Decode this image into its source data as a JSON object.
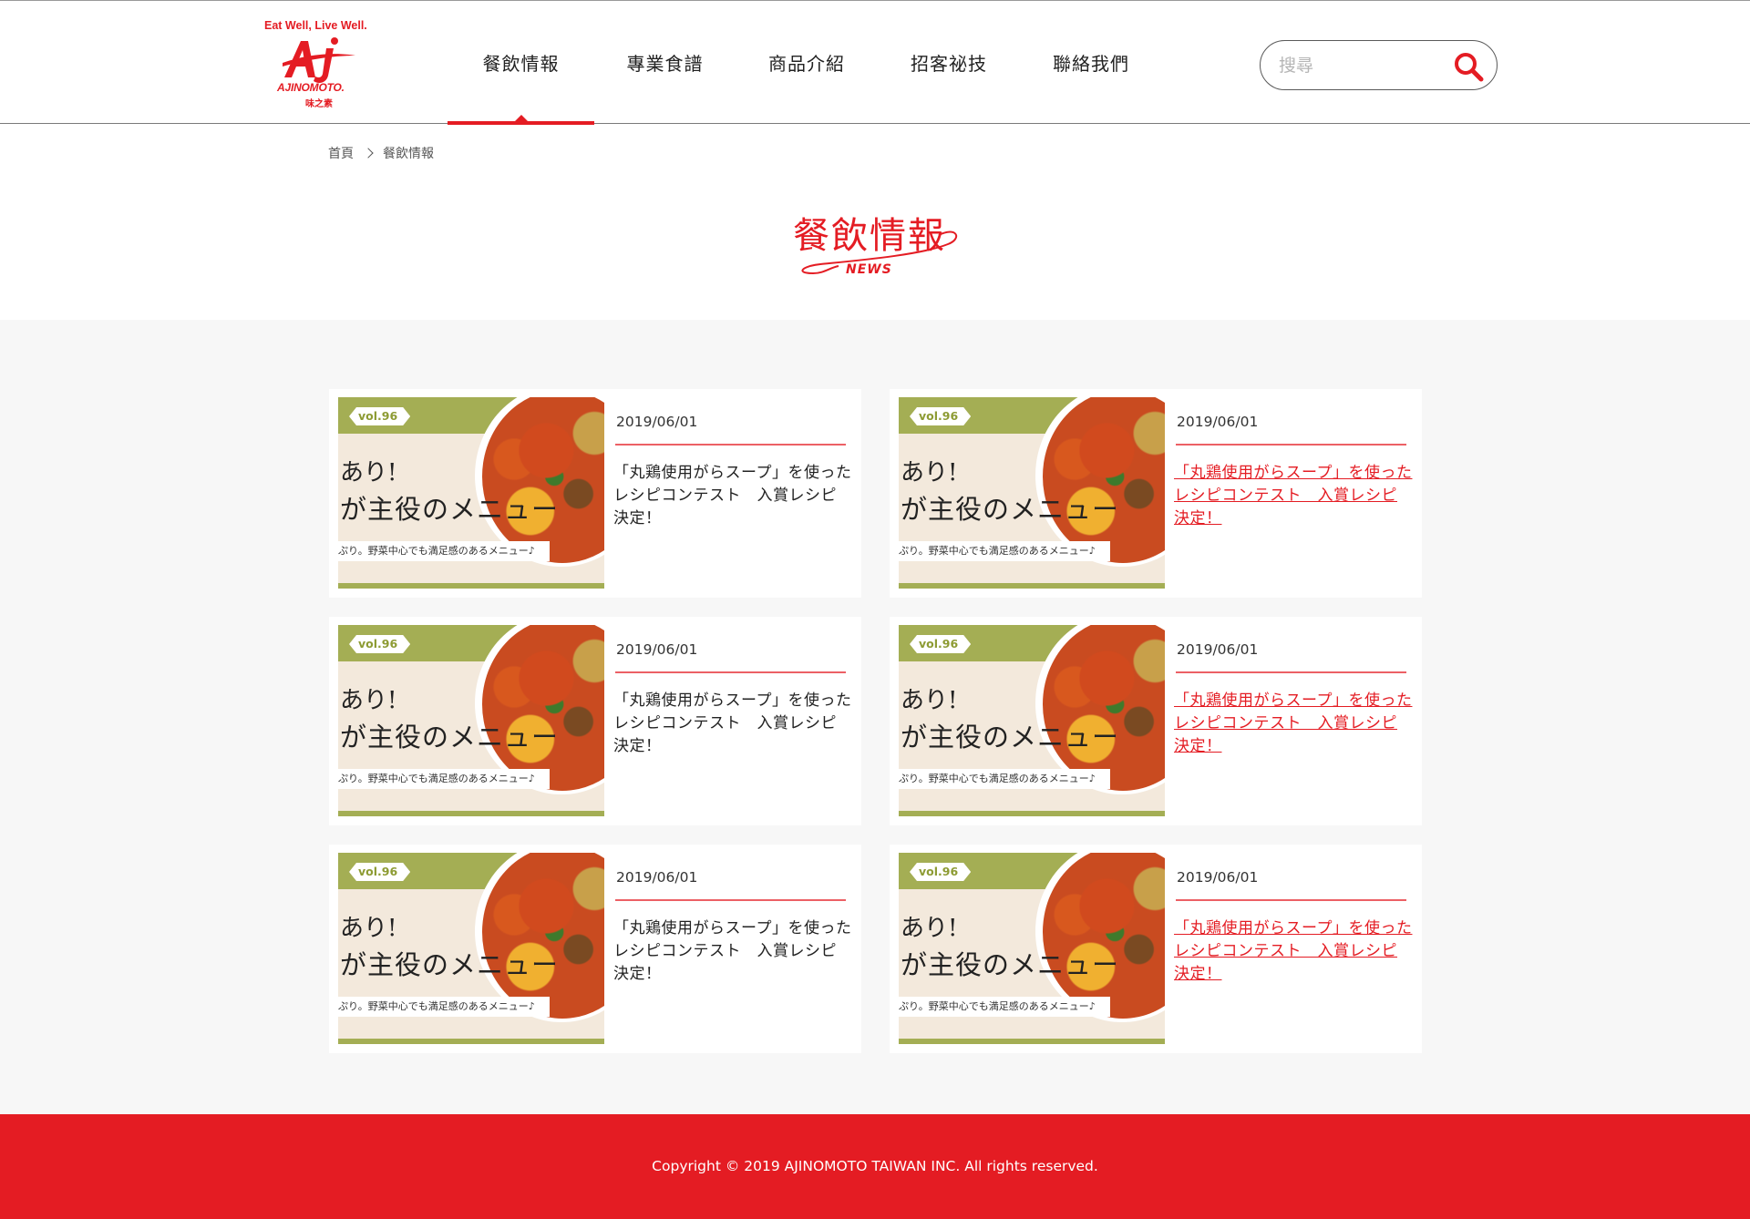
{
  "brand": {
    "tagline": "Eat Well, Live Well.",
    "name": "AJINOMOTO.",
    "name_zh": "味之素",
    "color": "#e41c23"
  },
  "nav": {
    "items": [
      {
        "label": "餐飲情報",
        "active": true
      },
      {
        "label": "專業食譜",
        "active": false
      },
      {
        "label": "商品介紹",
        "active": false
      },
      {
        "label": "招客祕技",
        "active": false
      },
      {
        "label": "聯絡我們",
        "active": false
      }
    ]
  },
  "search": {
    "placeholder": "搜尋",
    "icon": "search-icon"
  },
  "breadcrumb": {
    "home": "首頁",
    "current": "餐飲情報"
  },
  "page": {
    "title": "餐飲情報",
    "subtitle": "NEWS"
  },
  "thumbnail": {
    "vol": "vol.96",
    "head1": "あり!",
    "head2": "が主役のメニュー",
    "subline": "ぷり。野菜中心でも満足感のあるメニュー♪"
  },
  "news": [
    {
      "date": "2019/06/01",
      "title": "「丸鶏使用がらスープ」を使ったレシピコンテスト　入賞レシピ決定！",
      "linked": false
    },
    {
      "date": "2019/06/01",
      "title": "「丸鶏使用がらスープ」を使ったレシピコンテスト　入賞レシピ決定！",
      "linked": true
    },
    {
      "date": "2019/06/01",
      "title": "「丸鶏使用がらスープ」を使ったレシピコンテスト　入賞レシピ決定！",
      "linked": false
    },
    {
      "date": "2019/06/01",
      "title": "「丸鶏使用がらスープ」を使ったレシピコンテスト　入賞レシピ決定！",
      "linked": true
    },
    {
      "date": "2019/06/01",
      "title": "「丸鶏使用がらスープ」を使ったレシピコンテスト　入賞レシピ決定！",
      "linked": false
    },
    {
      "date": "2019/06/01",
      "title": "「丸鶏使用がらスープ」を使ったレシピコンテスト　入賞レシピ決定！",
      "linked": true
    }
  ],
  "footer": {
    "copyright": "Copyright © 2019 AJINOMOTO TAIWAN INC. All rights reserved."
  },
  "colors": {
    "accent": "#e41c23",
    "content_bg": "#f7f7f7",
    "thumb_green": "#a4ae54"
  }
}
